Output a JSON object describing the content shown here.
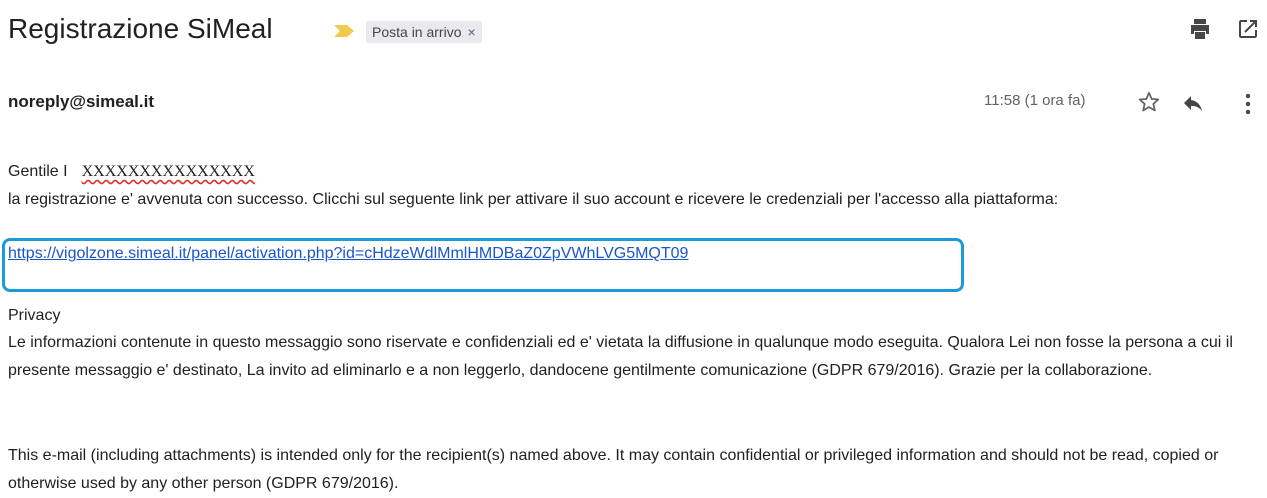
{
  "email": {
    "subject": "Registrazione SiMeal",
    "label": "Posta in arrivo",
    "label_close": "×",
    "sender": "noreply@simeal.it",
    "time": "11:58 (1 ora fa)",
    "greeting": "Gentile I",
    "recipient_redacted": "XXXXXXXXXXXXXXX",
    "line1": "la registrazione e' avvenuta con successo. Clicchi sul seguente link per attivare il suo account e ricevere le credenziali per l'accesso alla piattaforma:",
    "activation_link": "https://vigolzone.simeal.it/panel/activation.php?id=cHdzeWdlMmlHMDBaZ0ZpVWhLVG5MQT09",
    "privacy_title": "Privacy",
    "privacy_text": "Le informazioni contenute in questo messaggio sono riservate e confidenziali ed e' vietata la diffusione in qualunque modo eseguita. Qualora Lei non fosse la persona a cui il presente messaggio e' destinato, La invito ad eliminarlo e a non leggerlo, dandocene gentilmente comunicazione (GDPR 679/2016). Grazie per la collaborazione.",
    "english_text": "This e-mail (including attachments) is intended only for the recipient(s) named above. It may contain confidential or privileged information and should not be read, copied or otherwise used by any other person (GDPR 679/2016)."
  },
  "icons": {
    "important_marker": "important-marker-icon",
    "print": "print-icon",
    "open_new_window": "open-in-new-window-icon",
    "star": "star-icon",
    "reply": "reply-icon",
    "more": "more-vertical-icon"
  },
  "colors": {
    "important_marker": "#f2c94c",
    "link": "#1a56c9",
    "highlight_box": "#1a9bd7",
    "chip_background": "#e8eaed"
  }
}
